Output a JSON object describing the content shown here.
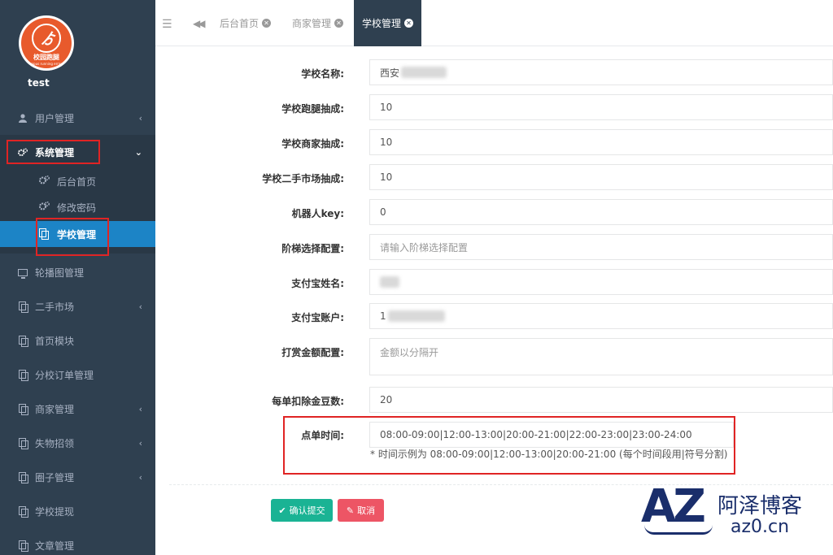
{
  "sidebar": {
    "username": "test",
    "logo_text": "校园跑腿",
    "logo_subtext": "campus running errands",
    "items": [
      {
        "label": "用户管理",
        "icon": "user-icon",
        "arrow": "‹"
      },
      {
        "label": "系统管理",
        "icon": "gears-icon",
        "arrow": "⌄"
      },
      {
        "label": "轮播图管理",
        "icon": "monitor-icon",
        "arrow": ""
      },
      {
        "label": "二手市场",
        "icon": "copy-icon",
        "arrow": "‹"
      },
      {
        "label": "首页模块",
        "icon": "copy-icon",
        "arrow": ""
      },
      {
        "label": "分校订单管理",
        "icon": "copy-icon",
        "arrow": ""
      },
      {
        "label": "商家管理",
        "icon": "copy-icon",
        "arrow": "‹"
      },
      {
        "label": "失物招领",
        "icon": "copy-icon",
        "arrow": "‹"
      },
      {
        "label": "圈子管理",
        "icon": "copy-icon",
        "arrow": "‹"
      },
      {
        "label": "学校提现",
        "icon": "copy-icon",
        "arrow": ""
      },
      {
        "label": "文章管理",
        "icon": "copy-icon",
        "arrow": ""
      }
    ],
    "subitems": [
      {
        "label": "后台首页",
        "icon": "gears-icon"
      },
      {
        "label": "修改密码",
        "icon": "gears-icon"
      },
      {
        "label": "学校管理",
        "icon": "copy-icon"
      }
    ]
  },
  "tabs": [
    {
      "label": "后台首页"
    },
    {
      "label": "商家管理"
    },
    {
      "label": "学校管理"
    }
  ],
  "form": {
    "school_name": {
      "label": "学校名称:",
      "value": "西安"
    },
    "errand_commission": {
      "label": "学校跑腿抽成:",
      "value": "10"
    },
    "merchant_commission": {
      "label": "学校商家抽成:",
      "value": "10"
    },
    "secondhand_commission": {
      "label": "学校二手市场抽成:",
      "value": "10"
    },
    "robot_key": {
      "label": "机器人key:",
      "value": "0"
    },
    "ladder_config": {
      "label": "阶梯选择配置:",
      "placeholder": "请输入阶梯选择配置"
    },
    "alipay_name": {
      "label": "支付宝姓名:",
      "value": ""
    },
    "alipay_account": {
      "label": "支付宝账户:",
      "value": "1"
    },
    "reward_config": {
      "label": "打赏金额配置:",
      "placeholder": "金额以分隔开"
    },
    "deduct_beans": {
      "label": "每单扣除金豆数:",
      "value": "20"
    },
    "order_time": {
      "label": "点单时间:",
      "value": "08:00-09:00|12:00-13:00|20:00-21:00|22:00-23:00|23:00-24:00",
      "help": "* 时间示例为 08:00-09:00|12:00-13:00|20:00-21:00 (每个时间段用|符号分割)"
    }
  },
  "buttons": {
    "confirm": "确认提交",
    "cancel": "取消"
  },
  "watermark": {
    "logo": "AZ",
    "cn": "阿泽博客",
    "en": "az0.cn"
  },
  "colors": {
    "sidebar_bg": "#2f4050",
    "active_item": "#1c84c6",
    "confirm": "#1ab394",
    "cancel": "#ed5565",
    "annotation": "#e02424"
  }
}
